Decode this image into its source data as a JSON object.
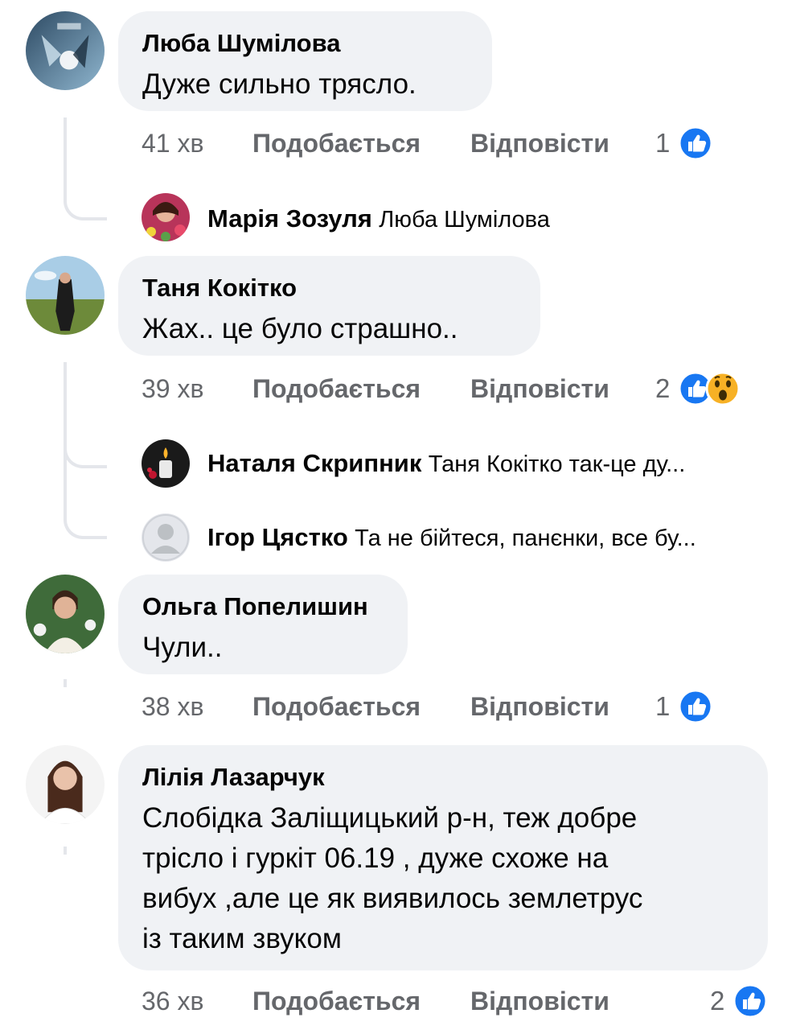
{
  "comments": [
    {
      "author": "Люба Шумілова",
      "text_lines": [
        "Дуже сильно трясло."
      ],
      "time": "41 хв",
      "like_label": "Подобається",
      "reply_label": "Відповісти",
      "reaction_count": "1",
      "reaction_icons": [
        "like-icon"
      ]
    },
    {
      "author": "Таня Кокітко",
      "text_lines": [
        "Жах.. це було страшно.."
      ],
      "time": "39 хв",
      "like_label": "Подобається",
      "reply_label": "Відповісти",
      "reaction_count": "2",
      "reaction_icons": [
        "like-icon",
        "wow-icon"
      ]
    },
    {
      "author": "Ольга Попелишин",
      "text_lines": [
        "Чули.."
      ],
      "time": "38 хв",
      "like_label": "Подобається",
      "reply_label": "Відповісти",
      "reaction_count": "1",
      "reaction_icons": [
        "like-icon"
      ]
    },
    {
      "author": "Лілія Лазарчук",
      "text_lines": [
        "Слобідка Заліщицький р-н, теж добре",
        "трісло і гуркіт 06.19 , дуже схоже на",
        "вибух ,але це як  виявилось землетрус",
        "із таким звуком"
      ],
      "time": "36 хв",
      "like_label": "Подобається",
      "reply_label": "Відповісти",
      "reaction_count": "2",
      "reaction_icons": [
        "like-icon"
      ]
    }
  ],
  "replies": [
    {
      "author": "Марія Зозуля",
      "text": "Люба Шумілова"
    },
    {
      "author": "Наталя Скрипник",
      "text": "Таня Кокітко так-це ду..."
    },
    {
      "author": "Ігор Цястко",
      "text": "Та не бійтеся, панєнки, все бу..."
    }
  ],
  "colors": {
    "bubble": "#f0f2f5",
    "meta_text": "#65676b",
    "like_blue": "#1877f2",
    "wow_yellow": "#f7b125",
    "thread_line": "#e4e6eb"
  }
}
